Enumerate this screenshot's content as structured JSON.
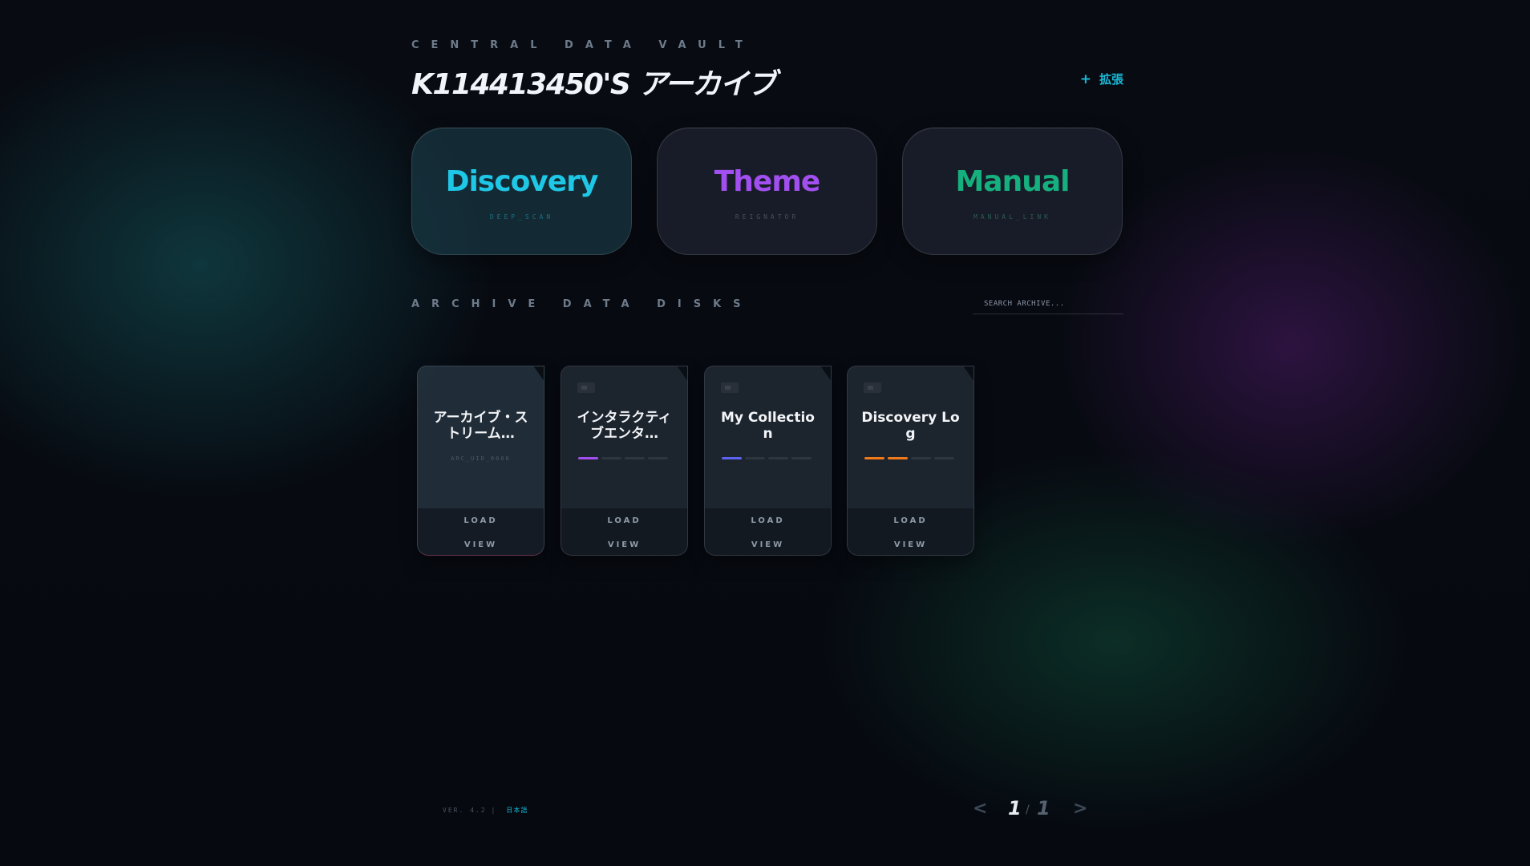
{
  "header": {
    "kicker": "CENTRAL DATA VAULT",
    "title": "K114413450'S アーカイブ",
    "expand_label": "拡張",
    "expand_icon": "plus-icon"
  },
  "features": [
    {
      "title": "Discovery",
      "subtitle": "DEEP_SCAN",
      "color": "#1fc7e6",
      "sub_color": "#1d6f80"
    },
    {
      "title": "Theme",
      "subtitle": "REIGNATOR",
      "color": "#a24ff0",
      "sub_color": "#4a4d5c"
    },
    {
      "title": "Manual",
      "subtitle": "MANUAL_LINK",
      "color": "#16b07e",
      "sub_color": "#2a5c50"
    }
  ],
  "section": {
    "label": "ARCHIVE DATA DISKS",
    "search_placeholder": "SEARCH ARCHIVE..."
  },
  "disks": [
    {
      "name": "アーカイブ・ストリーム…",
      "code": "ARC_UID_0000",
      "load": "LOAD",
      "view": "VIEW",
      "progress": 0,
      "color": ""
    },
    {
      "name": "インタラクティブエンタ…",
      "code": "",
      "load": "LOAD",
      "view": "VIEW",
      "progress": 1,
      "color": "#a24ff0"
    },
    {
      "name": "My Collection",
      "code": "",
      "load": "LOAD",
      "view": "VIEW",
      "progress": 1,
      "color": "#5b63f0"
    },
    {
      "name": "Discovery Log",
      "code": "",
      "load": "LOAD",
      "view": "VIEW",
      "progress": 2,
      "color": "#f07a1a"
    }
  ],
  "footer": {
    "version": "VER. 4.2",
    "separator": "|",
    "language": "日本語"
  },
  "pagination": {
    "prev": "<",
    "current": "1",
    "slash": "/",
    "total": "1",
    "next": ">"
  }
}
